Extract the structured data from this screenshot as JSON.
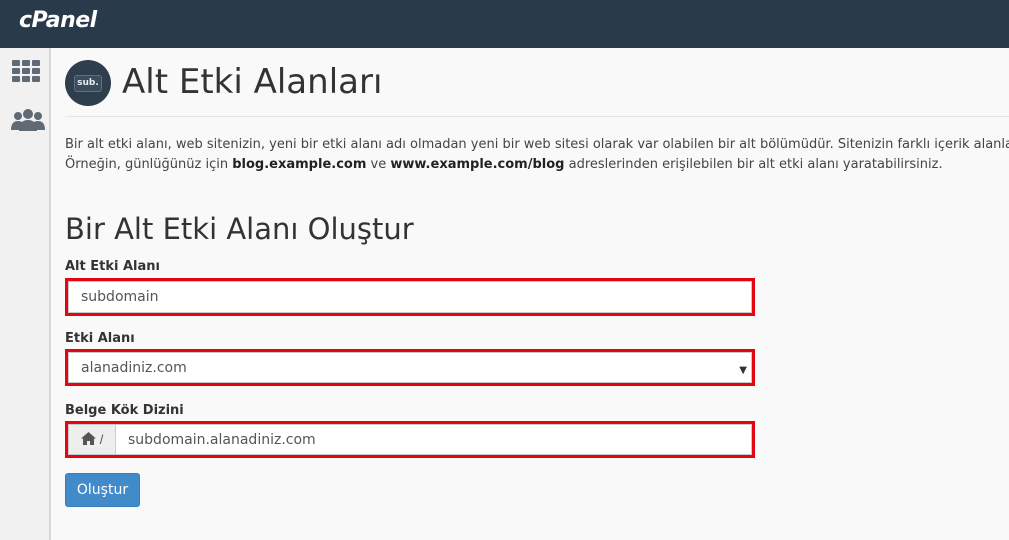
{
  "app": {
    "logo_text": "cPanel"
  },
  "sidebar": {
    "items": [
      {
        "icon": "grid-icon"
      },
      {
        "icon": "users-icon"
      }
    ]
  },
  "header": {
    "icon_text": "sub.",
    "title": "Alt Etki Alanları"
  },
  "description": {
    "line1": "Bir alt etki alanı, web sitenizin, yeni bir etki alanı adı olmadan yeni bir web sitesi olarak var olabilen bir alt bölümüdür. Sitenizin farklı içerik alanları",
    "line2_prefix": "Örneğin, günlüğünüz için ",
    "line2_bold1": "blog.example.com",
    "line2_middle": " ve ",
    "line2_bold2": "www.example.com/blog",
    "line2_suffix": " adreslerinden erişilebilen bir alt etki alanı yaratabilirsiniz."
  },
  "form": {
    "title": "Bir Alt Etki Alanı Oluştur",
    "subdomain": {
      "label": "Alt Etki Alanı",
      "value": "subdomain"
    },
    "domain": {
      "label": "Etki Alanı",
      "selected": "alanadiniz.com"
    },
    "docroot": {
      "label": "Belge Kök Dizini",
      "prefix": "/",
      "value": "subdomain.alanadiniz.com"
    },
    "submit_label": "Oluştur"
  },
  "colors": {
    "topbar": "#293a4a",
    "highlight": "#e3050f",
    "button": "#428bca"
  }
}
